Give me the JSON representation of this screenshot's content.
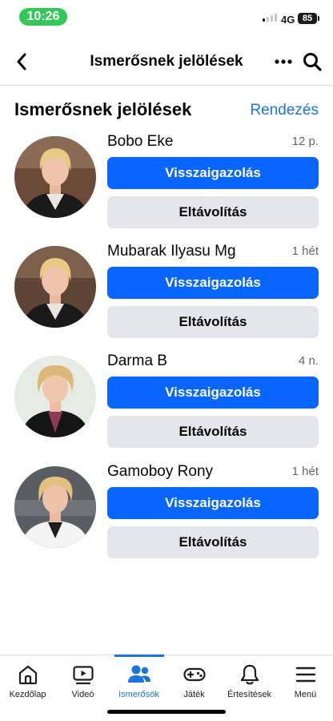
{
  "status": {
    "time": "10:26",
    "network": "4G",
    "battery": "85"
  },
  "header": {
    "title": "Ismerősnek jelölések"
  },
  "section": {
    "title": "Ismerősnek jelölések",
    "sort_label": "Rendezés"
  },
  "requests": [
    {
      "name": "Bobo Eke",
      "time": "12 p.",
      "confirm_label": "Visszaigazolás",
      "delete_label": "Eltávolítás"
    },
    {
      "name": "Mubarak Ilyasu Mg",
      "time": "1 hét",
      "confirm_label": "Visszaigazolás",
      "delete_label": "Eltávolítás"
    },
    {
      "name": "Darma B",
      "time": "4 n.",
      "confirm_label": "Visszaigazolás",
      "delete_label": "Eltávolítás"
    },
    {
      "name": "Gamoboy Rony",
      "time": "1 hét",
      "confirm_label": "Visszaigazolás",
      "delete_label": "Eltávolítás"
    }
  ],
  "nav": [
    {
      "label": "Kezdőlap",
      "icon": "home-icon"
    },
    {
      "label": "Videó",
      "icon": "video-icon"
    },
    {
      "label": "Ismerősök",
      "icon": "friends-icon",
      "active": true
    },
    {
      "label": "Játék",
      "icon": "gamepad-icon"
    },
    {
      "label": "Értesítések",
      "icon": "bell-icon"
    },
    {
      "label": "Menü",
      "icon": "menu-icon"
    }
  ],
  "colors": {
    "accent": "#1b74e4",
    "confirm_button": "#0866ff",
    "delete_button": "#e4e6eb"
  }
}
